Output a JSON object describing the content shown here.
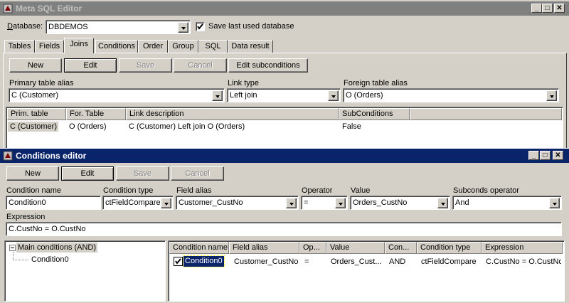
{
  "meta_window": {
    "title": "Meta SQL Editor",
    "database_label": "Database:",
    "database_value": "DBDEMOS",
    "save_last_label": "Save last used database",
    "save_last_checked": true,
    "tabs": [
      "Tables",
      "Fields",
      "Joins",
      "Conditions",
      "Order",
      "Group",
      "SQL",
      "Data result"
    ],
    "active_tab": "Joins",
    "buttons": {
      "new": "New",
      "edit": "Edit",
      "save": "Save",
      "cancel": "Cancel",
      "edit_sub": "Edit subconditions"
    },
    "primary_alias_label": "Primary table alias",
    "primary_alias_value": "C (Customer)",
    "link_type_label": "Link type",
    "link_type_value": "Left join",
    "foreign_alias_label": "Foreign table alias",
    "foreign_alias_value": "O (Orders)",
    "grid_headers": [
      "Prim. table",
      "For. Table",
      "Link description",
      "SubConditions"
    ],
    "grid_row": [
      "C (Customer)",
      "O (Orders)",
      "C (Customer) Left join O (Orders)",
      "False"
    ]
  },
  "cond_window": {
    "title": "Conditions editor",
    "buttons": {
      "new": "New",
      "edit": "Edit",
      "save": "Save",
      "cancel": "Cancel"
    },
    "cond_name_label": "Condition name",
    "cond_name_value": "Condition0",
    "cond_type_label": "Condition type",
    "cond_type_value": "ctFieldCompare",
    "field_alias_label": "Field alias",
    "field_alias_value": "Customer_CustNo",
    "operator_label": "Operator",
    "operator_value": "=",
    "value_label": "Value",
    "value_value": "Orders_CustNo",
    "subconds_label": "Subconds operator",
    "subconds_value": "And",
    "expression_label": "Expression",
    "expression_value": "C.CustNo = O.CustNo",
    "tree_root": "Main conditions (AND)",
    "tree_child": "Condition0",
    "list_headers": [
      "Condition name",
      "Field alias",
      "Op...",
      "Value",
      "Con...",
      "Condition type",
      "Expression"
    ],
    "list_row": [
      "Condition0",
      "Customer_CustNo",
      "=",
      "Orders_Cust...",
      "AND",
      "ctFieldCompare",
      "C.CustNo = O.CustNo"
    ]
  },
  "colors": {
    "inactive_title": "#808080",
    "active_title": "#0a246a",
    "face": "#d4d0c8",
    "selection": "#0a246a"
  }
}
